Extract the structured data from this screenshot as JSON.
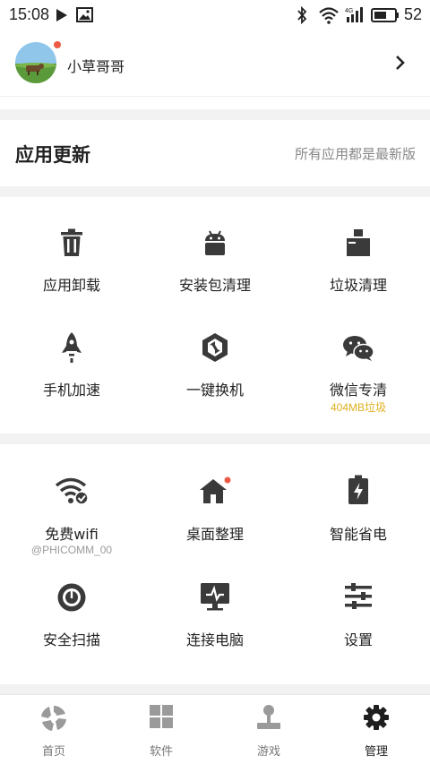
{
  "status_bar": {
    "time": "15:08",
    "network": "4G",
    "battery": "52",
    "icons": [
      "play-icon",
      "gallery-icon",
      "bluetooth-icon",
      "wifi-icon",
      "signal-icon",
      "battery-icon"
    ]
  },
  "profile": {
    "username": "小草哥哥",
    "has_notification": true
  },
  "update": {
    "title": "应用更新",
    "status": "所有应用都是最新版"
  },
  "tools": [
    {
      "label": "应用卸载",
      "icon": "trash-icon"
    },
    {
      "label": "安装包清理",
      "icon": "android-icon"
    },
    {
      "label": "垃圾清理",
      "icon": "broom-icon"
    },
    {
      "label": "手机加速",
      "icon": "rocket-icon"
    },
    {
      "label": "一键换机",
      "icon": "phone-switch-icon"
    },
    {
      "label": "微信专清",
      "icon": "wechat-icon",
      "sub": "404MB垃圾"
    }
  ],
  "utilities": [
    {
      "label": "免费wifi",
      "icon": "wifi-check-icon",
      "sub": "@PHICOMM_00"
    },
    {
      "label": "桌面整理",
      "icon": "home-icon",
      "badge": true
    },
    {
      "label": "智能省电",
      "icon": "battery-charge-icon"
    },
    {
      "label": "安全扫描",
      "icon": "scan-icon"
    },
    {
      "label": "连接电脑",
      "icon": "computer-icon"
    },
    {
      "label": "设置",
      "icon": "sliders-icon"
    }
  ],
  "tabs": [
    {
      "label": "首页",
      "icon": "home-logo-icon",
      "active": false
    },
    {
      "label": "软件",
      "icon": "apps-grid-icon",
      "active": false
    },
    {
      "label": "游戏",
      "icon": "joystick-icon",
      "active": false
    },
    {
      "label": "管理",
      "icon": "gear-icon",
      "active": true
    }
  ],
  "colors": {
    "accent": "#f0c020",
    "badge": "#ee5a45",
    "icon": "#3a3a3a",
    "tab_inactive": "#9a9a9a",
    "separator": "#f2f2f2"
  }
}
